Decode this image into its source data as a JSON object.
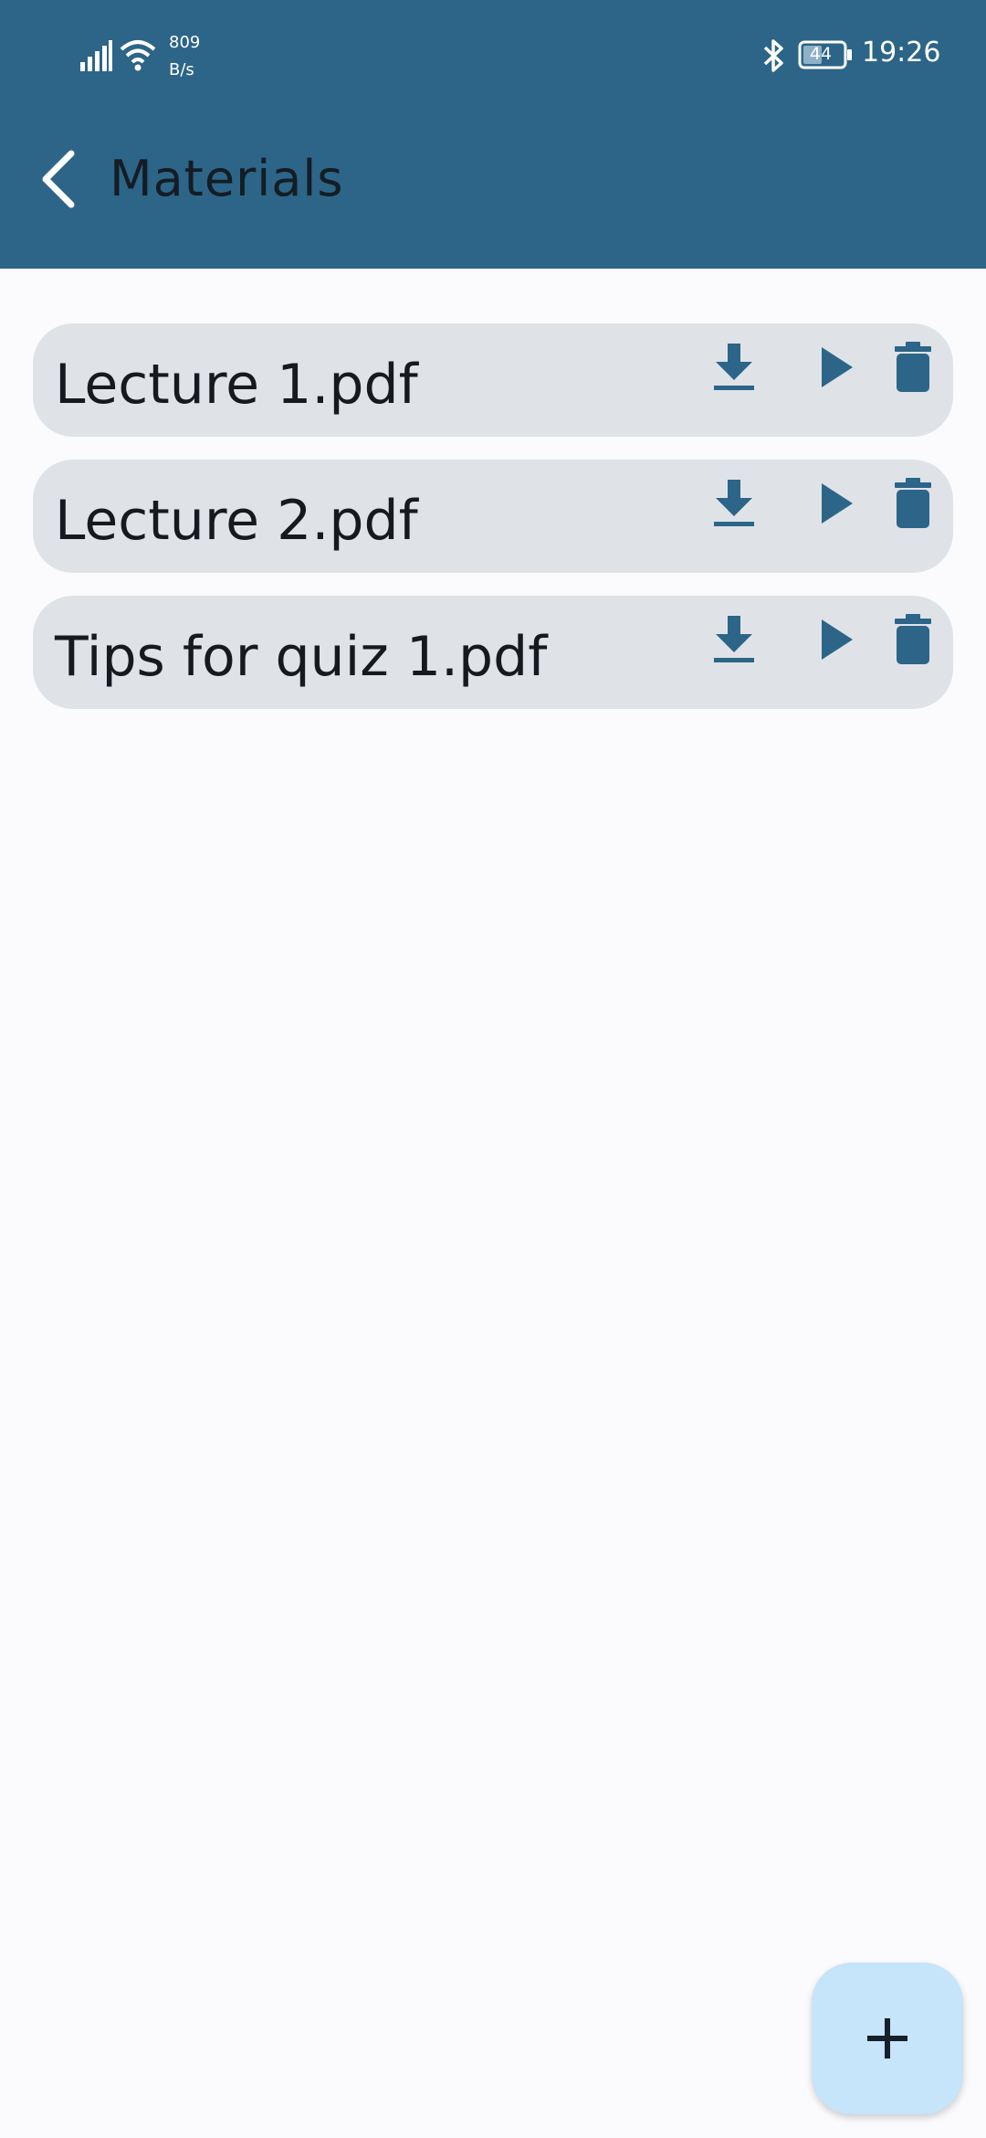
{
  "status_bar": {
    "net_speed_value": "809",
    "net_speed_unit": "B/s",
    "battery": "44",
    "time": "19:26"
  },
  "header": {
    "title": "Materials"
  },
  "materials": [
    {
      "name": "Lecture 1.pdf"
    },
    {
      "name": "Lecture 2.pdf"
    },
    {
      "name": "Tips for quiz 1.pdf"
    }
  ],
  "icons": {
    "download": "download-icon",
    "open": "play-icon",
    "delete": "trash-icon",
    "add": "plus-icon",
    "back": "chevron-left-icon"
  },
  "colors": {
    "primary": "#2c6587",
    "item_bg": "#dfe3e8",
    "fab_bg": "#c6e4fa"
  }
}
